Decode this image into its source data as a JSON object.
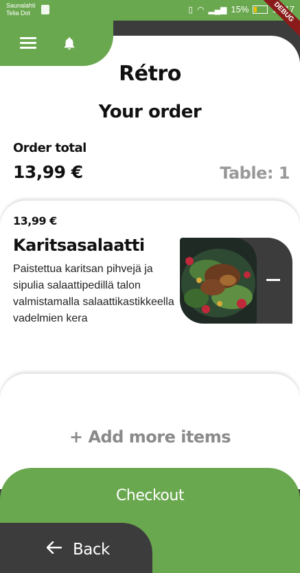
{
  "status_bar": {
    "carrier_line1": "Saunalahti",
    "carrier_line2": "Telia Dot",
    "battery": "15%",
    "time": "16:17",
    "debug_label": "DEBUG"
  },
  "header": {
    "menu_icon": "hamburger-menu-icon",
    "bell_icon": "bell-icon"
  },
  "restaurant": {
    "name": "Rétro"
  },
  "order": {
    "heading": "Your order",
    "total_label": "Order total",
    "total_value": "13,99 €",
    "table_label": "Table: 1"
  },
  "items": [
    {
      "price": "13,99 €",
      "name": "Karitsasalaatti",
      "description": "Paistettua karitsan pihvejä ja sipulia salaattipedillä talon valmistamalla salaattikastikkeella vadelmien kera",
      "remove_icon": "minus-icon"
    }
  ],
  "add_more_label": "+ Add more items",
  "checkout_label": "Checkout",
  "back_label": "Back",
  "colors": {
    "brand_green": "#6aa84f",
    "dark": "#3c3c3c",
    "muted": "#999999"
  }
}
